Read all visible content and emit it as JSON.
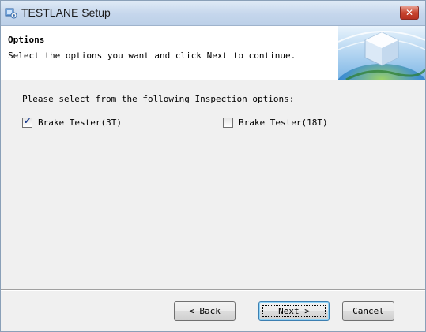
{
  "window": {
    "title": "TESTLANE Setup",
    "close_glyph": "✕"
  },
  "header": {
    "title": "Options",
    "subtitle": "Select the options you want and click Next to continue."
  },
  "content": {
    "instruction": "Please select from the following Inspection options:",
    "options": [
      {
        "label": "Brake Tester(3T)",
        "checked": true
      },
      {
        "label": "Brake Tester(18T)",
        "checked": false
      }
    ]
  },
  "buttons": {
    "back": {
      "prefix": "< ",
      "mnemonic": "B",
      "rest": "ack"
    },
    "next": {
      "mnemonic": "N",
      "rest": "ext >"
    },
    "cancel": {
      "mnemonic": "C",
      "rest": "ancel"
    }
  },
  "colors": {
    "titlebar": "#c5d6ec",
    "close": "#c8452f",
    "checkmark": "#1b3c8c",
    "default_button_border": "#3c7fb1"
  },
  "icons": {
    "app": "installer-icon",
    "banner": "setup-cube-globe-banner"
  }
}
